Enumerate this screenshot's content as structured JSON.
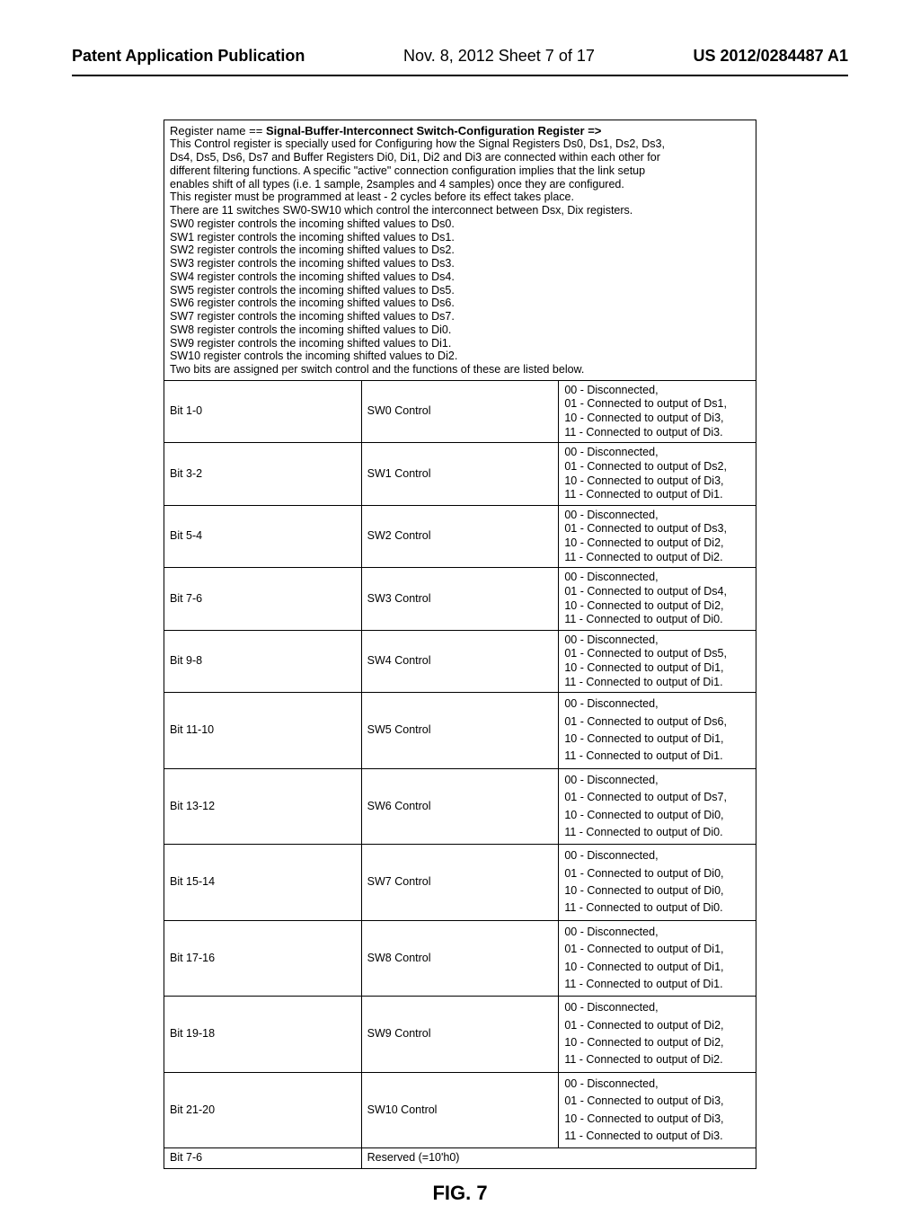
{
  "header": {
    "left": "Patent Application Publication",
    "center": "Nov. 8, 2012   Sheet 7 of 17",
    "right": "US 2012/0284487 A1"
  },
  "desc": {
    "title_prefix": "Register name  ==  ",
    "title_bold": "Signal-Buffer-Interconnect Switch-Configuration Register =>",
    "body_lines": [
      "This Control register is specially used for Configuring how the Signal Registers Ds0, Ds1, Ds2, Ds3,",
      "Ds4, Ds5, Ds6, Ds7 and Buffer Registers Di0, Di1, Di2 and Di3 are connected within each other for",
      "different filtering functions. A specific \"active\" connection configuration implies that the link setup",
      "enables shift of all types (i.e. 1 sample, 2samples and 4 samples) once they are configured.",
      "This register must be programmed at least - 2 cycles before its effect takes place.",
      "There are 11 switches SW0-SW10 which control the interconnect between Dsx, Dix registers.",
      "SW0 register controls the incoming shifted values to Ds0.",
      "SW1 register controls the incoming shifted values to Ds1.",
      "SW2 register controls the incoming shifted values to Ds2.",
      "SW3 register controls the incoming shifted values to Ds3.",
      "SW4 register controls the incoming shifted values to Ds4.",
      "SW5 register controls the incoming shifted values to Ds5.",
      "SW6 register controls the incoming shifted values to Ds6.",
      "SW7 register controls the incoming shifted values to Ds7.",
      "SW8 register controls the incoming shifted values to Di0.",
      "SW9 register controls the incoming shifted values to Di1.",
      "SW10 register controls the incoming shifted values to Di2.",
      "Two bits are assigned per switch control and the functions of these are listed below."
    ]
  },
  "rows": [
    {
      "bit": "Bit 1-0",
      "name": "SW0 Control",
      "lines": [
        "00 - Disconnected,",
        "01 - Connected to output of Ds1,",
        "10 - Connected to output of Di3,",
        "11 - Connected to output of Di3."
      ]
    },
    {
      "bit": "Bit 3-2",
      "name": "SW1 Control",
      "lines": [
        "00 - Disconnected,",
        "01 - Connected to output of Ds2,",
        "10 - Connected to output of Di3,",
        "11 - Connected to output of Di1."
      ]
    },
    {
      "bit": "Bit 5-4",
      "name": "SW2 Control",
      "lines": [
        "00 - Disconnected,",
        "01 - Connected to output of Ds3,",
        "10 - Connected to output of Di2,",
        "11 - Connected to output of Di2."
      ]
    },
    {
      "bit": "Bit 7-6",
      "name": "SW3 Control",
      "lines": [
        "00 - Disconnected,",
        "01 - Connected to output of Ds4,",
        "10 - Connected to output of Di2,",
        "11 - Connected to output of Di0."
      ]
    },
    {
      "bit": "Bit 9-8",
      "name": "SW4 Control",
      "lines": [
        "00 - Disconnected,",
        "01 - Connected to output of Ds5,",
        "10 - Connected to output of Di1,",
        "11 - Connected to output of Di1."
      ]
    },
    {
      "bit": "Bit 11-10",
      "name": "SW5 Control",
      "lines": [
        "00 - Disconnected,",
        "01 - Connected to output of Ds6,",
        "10 - Connected to output of Di1,",
        "11 - Connected to output of Di1."
      ]
    },
    {
      "bit": "Bit 13-12",
      "name": "SW6 Control",
      "lines": [
        "00 - Disconnected,",
        "01 - Connected to output of Ds7,",
        "10 - Connected to output of Di0,",
        "11 - Connected to output of Di0."
      ]
    },
    {
      "bit": "Bit 15-14",
      "name": "SW7 Control",
      "lines": [
        "00 - Disconnected,",
        "01 - Connected to output of Di0,",
        "10 - Connected to output of Di0,",
        "11 - Connected to output of Di0."
      ]
    },
    {
      "bit": "Bit 17-16",
      "name": "SW8 Control",
      "lines": [
        "00 - Disconnected,",
        "01 - Connected to output of Di1,",
        "10 - Connected to output of Di1,",
        "11 - Connected to output of Di1."
      ]
    },
    {
      "bit": "Bit 19-18",
      "name": "SW9 Control",
      "lines": [
        "00 - Disconnected,",
        "01 - Connected to output of Di2,",
        "10 - Connected to output of Di2,",
        "11 - Connected to output of Di2."
      ]
    },
    {
      "bit": "Bit 21-20",
      "name": "SW10 Control",
      "lines": [
        "00 - Disconnected,",
        "01 - Connected to output of Di3,",
        "10 - Connected to output of Di3,",
        "11 - Connected to output of Di3."
      ]
    }
  ],
  "last_row": {
    "bit": "Bit 7-6",
    "name": "Reserved (=10'h0)"
  },
  "figure_label": "FIG. 7"
}
